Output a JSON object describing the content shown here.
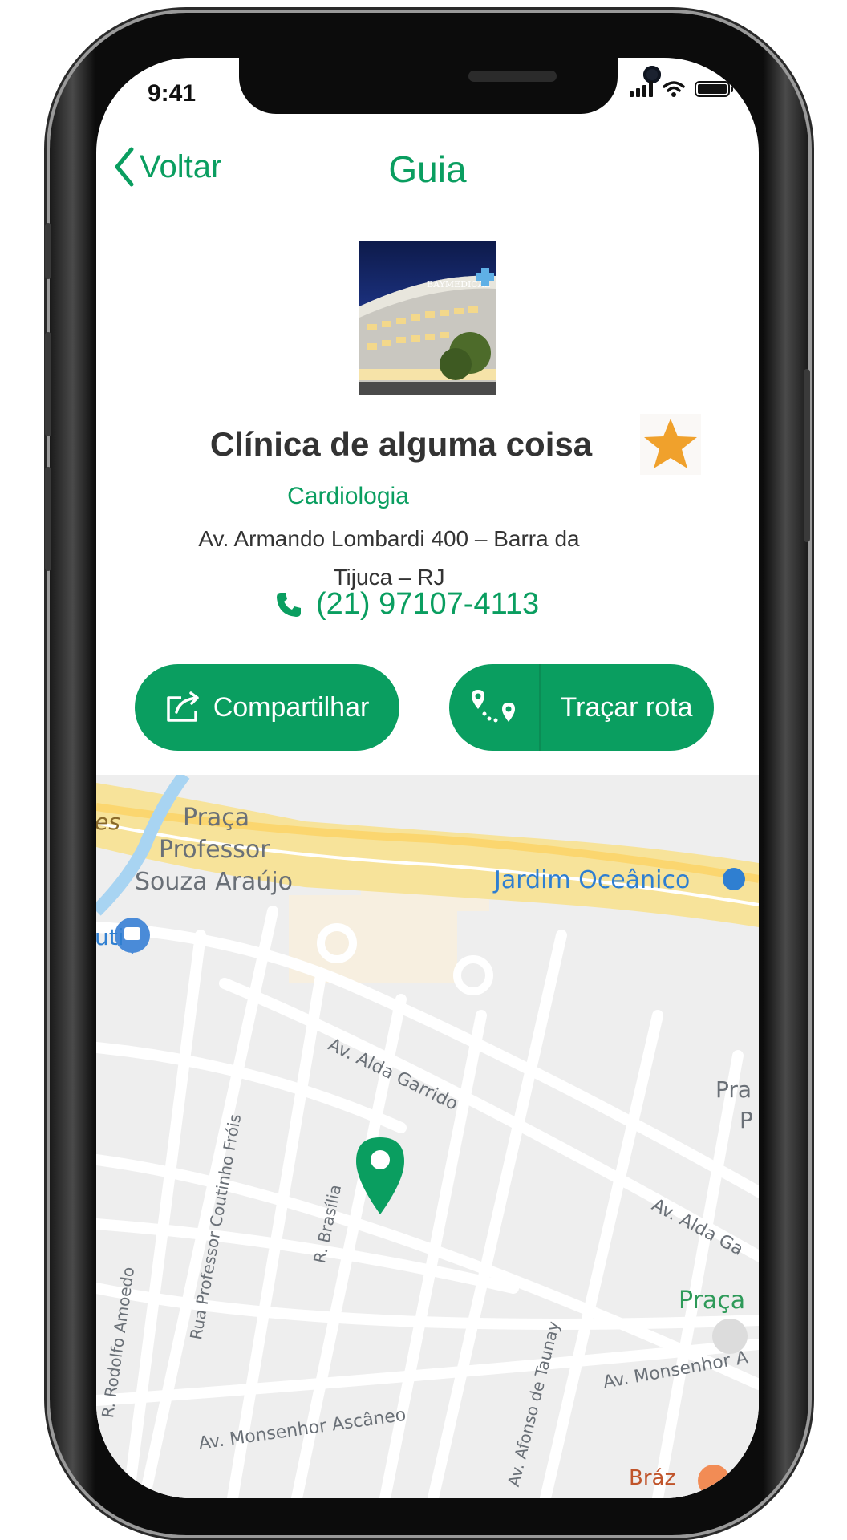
{
  "status_bar": {
    "time": "9:41"
  },
  "header": {
    "back_label": "Voltar",
    "title": "Guia"
  },
  "clinic": {
    "photo_text": "BAYMEDICAL",
    "name": "Clínica de alguma coisa",
    "specialty": "Cardiologia",
    "address": "Av. Armando Lombardi 400 – Barra da Tijuca – RJ",
    "phone": "(21) 97107-4113",
    "favorite": true
  },
  "actions": {
    "share_label": "Compartilhar",
    "route_label": "Traçar rota"
  },
  "map": {
    "labels": {
      "praca_1": "Praça",
      "praca_2": "Professor",
      "praca_3": "Souza Araújo",
      "jardim": "Jardim Oceânico",
      "uti": "uti",
      "alda1": "Av. Alda Garrido",
      "alda2": "Av. Alda Ga",
      "coutinho": "Rua Professor Coutinho Fróis",
      "brasilia": "R. Brasília",
      "rodolfo": "R. Rodolfo Amoedo",
      "afonso": "Av. Afonso de Taunay",
      "monsenhor1": "Av. Monsenhor Ascâneo",
      "monsenhor2": "Av. Monsenhor A",
      "praca_right": "Praça",
      "pra_edge1": "Pra",
      "pra_edge2": "P",
      "braz": "Bráz",
      "es": "es"
    }
  },
  "colors": {
    "accent": "#0a9e60",
    "star": "#f0a12c",
    "highway": "#f7e39a"
  }
}
